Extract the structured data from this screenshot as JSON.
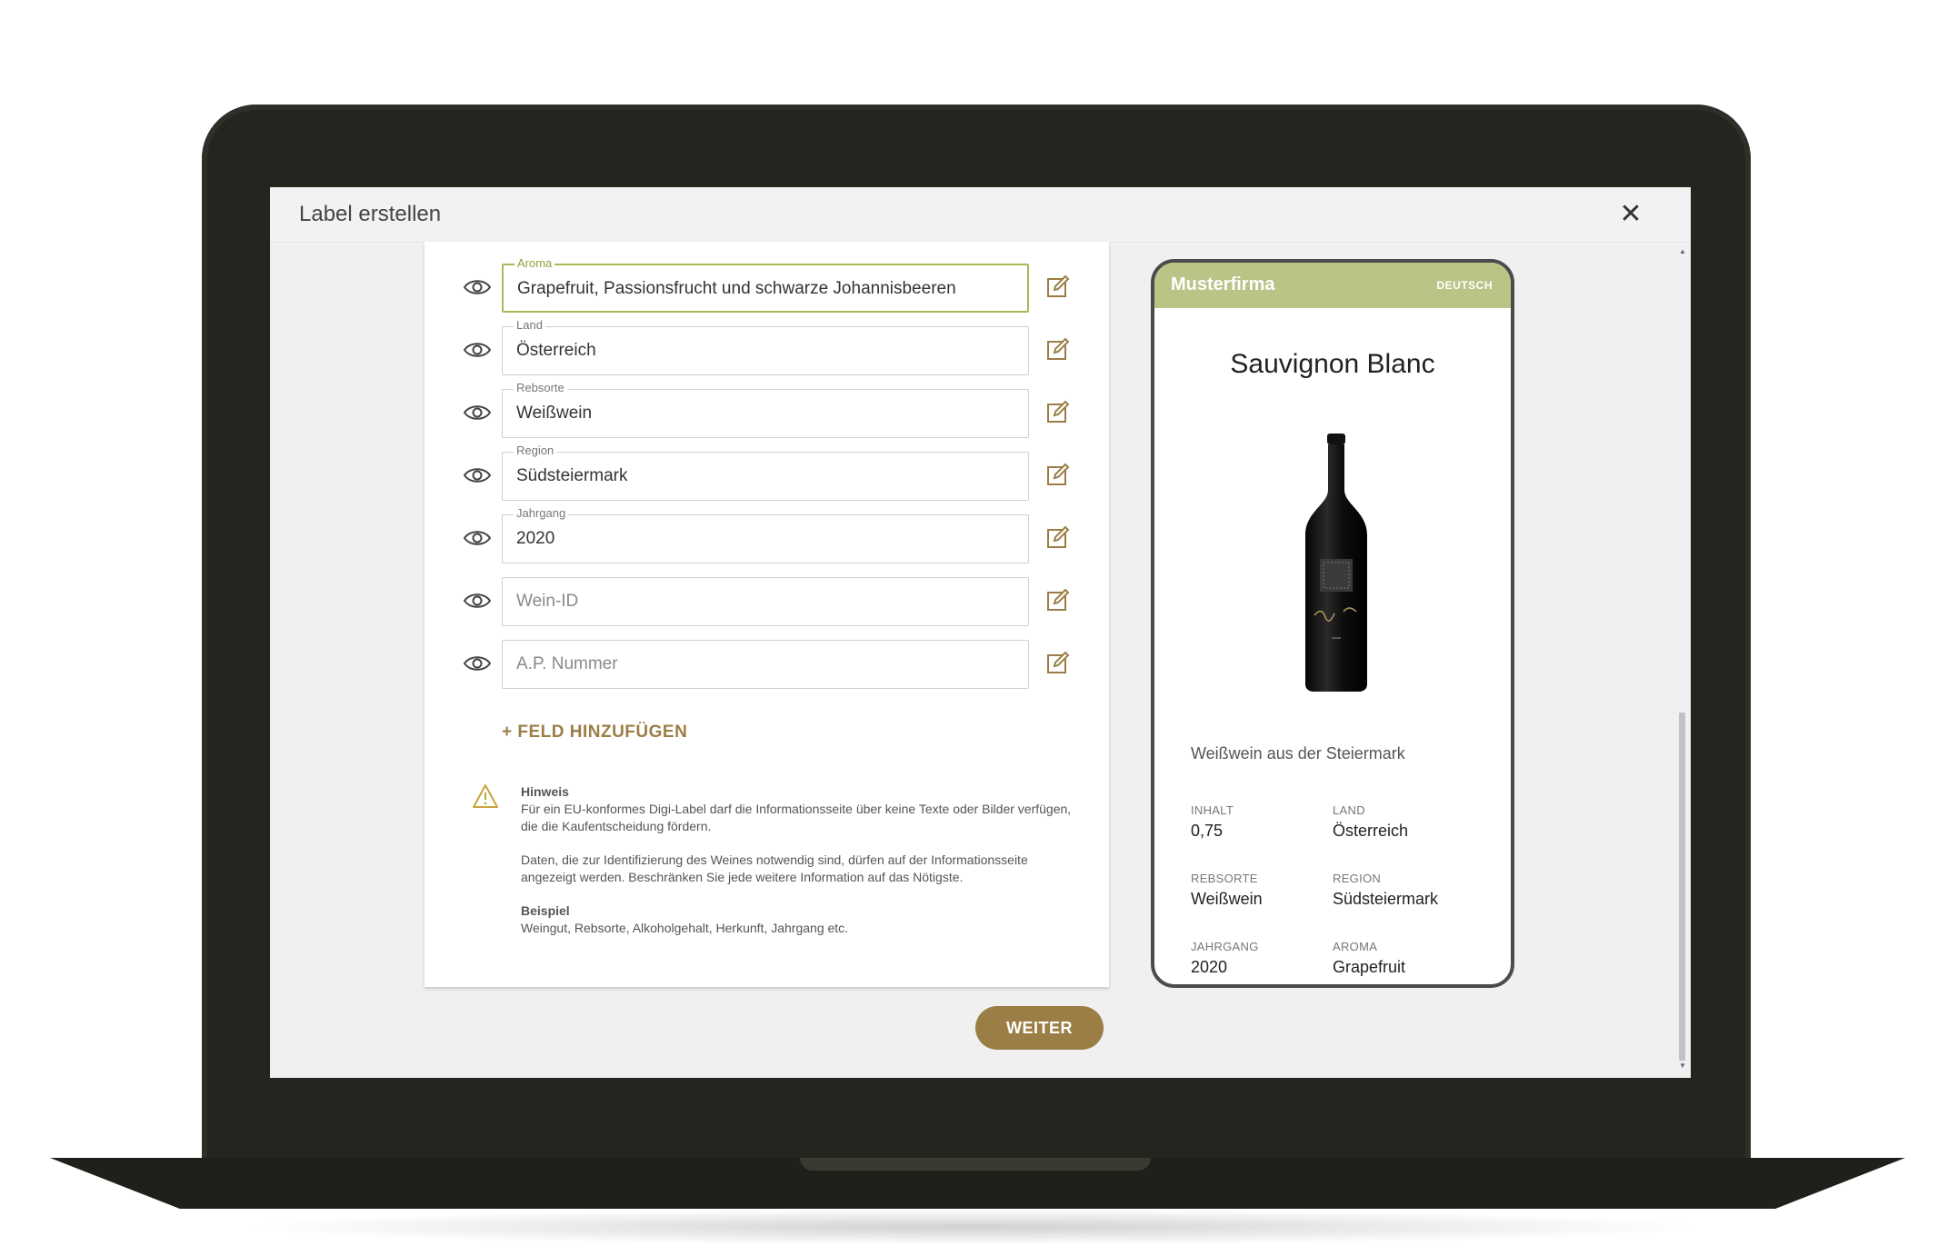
{
  "dialog": {
    "title": "Label erstellen",
    "close_label": "✕"
  },
  "fields": [
    {
      "label": "Aroma",
      "value": "Grapefruit, Passionsfrucht und schwarze Johannisbeeren",
      "active": true
    },
    {
      "label": "Land",
      "value": "Österreich"
    },
    {
      "label": "Rebsorte",
      "value": "Weißwein"
    },
    {
      "label": "Region",
      "value": "Südsteiermark"
    },
    {
      "label": "Jahrgang",
      "value": "2020"
    },
    {
      "label": "",
      "placeholder": "Wein-ID"
    },
    {
      "label": "",
      "placeholder": "A.P. Nummer"
    }
  ],
  "add_field_label": "+  FELD HINZUFÜGEN",
  "notice": {
    "heading": "Hinweis",
    "text1": "Für ein EU-konformes Digi-Label darf die Informationsseite über keine Texte oder Bilder verfügen, die die Kaufentscheidung fördern.",
    "text2": "Daten, die zur Identifizierung des Weines notwendig sind, dürfen auf der Informationsseite angezeigt werden. Beschränken Sie jede weitere Information auf das Nötigste.",
    "example_heading": "Beispiel",
    "example_text": "Weingut, Rebsorte, Alkoholgehalt, Herkunft, Jahrgang etc."
  },
  "next_button": "WEITER",
  "preview": {
    "brand": "Musterfirma",
    "language": "DEUTSCH",
    "wine_name": "Sauvignon Blanc",
    "description": "Weißwein aus der Steiermark",
    "specs": [
      {
        "label": "INHALT",
        "value": "0,75"
      },
      {
        "label": "LAND",
        "value": "Österreich"
      },
      {
        "label": "REBSORTE",
        "value": "Weißwein"
      },
      {
        "label": "REGION",
        "value": "Südsteiermark"
      },
      {
        "label": "JAHRGANG",
        "value": "2020"
      },
      {
        "label": "AROMA",
        "value": "Grapefruit"
      }
    ],
    "bar_color": "#b8c587"
  },
  "colors": {
    "accent_gold": "#9b7e45",
    "accent_green": "#a6ba56"
  },
  "icons": [
    "eye-icon",
    "edit-icon",
    "warning-icon",
    "close-icon",
    "wine-bottle-image"
  ]
}
